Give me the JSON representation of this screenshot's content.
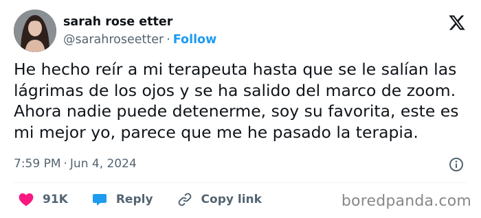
{
  "author": {
    "name": "sarah rose etter",
    "handle": "@sarahroseetter",
    "separator": "·",
    "follow_label": "Follow"
  },
  "tweet": {
    "text": "He hecho reír a mi terapeuta hasta que se le salían las\nlágrimas de los ojos y se ha salido del marco de zoom.\nAhora nadie puede detenerme, soy su favorita, este es\nmi mejor yo, parece que me he pasado la terapia.",
    "time": "7:59 PM",
    "meta_separator": "·",
    "date": "Jun 4, 2024"
  },
  "actions": {
    "likes": "91K",
    "reply_label": "Reply",
    "copy_link_label": "Copy link"
  },
  "icons": {
    "platform_logo": "x-logo-icon",
    "info": "info-icon",
    "like": "heart-icon",
    "reply": "reply-bubble-icon",
    "copy": "link-icon"
  },
  "colors": {
    "like": "#f91880",
    "reply": "#1d9bf0",
    "follow": "#1d9bf0",
    "muted": "#536471",
    "text": "#0f1419"
  },
  "watermark": "boredpanda.com"
}
